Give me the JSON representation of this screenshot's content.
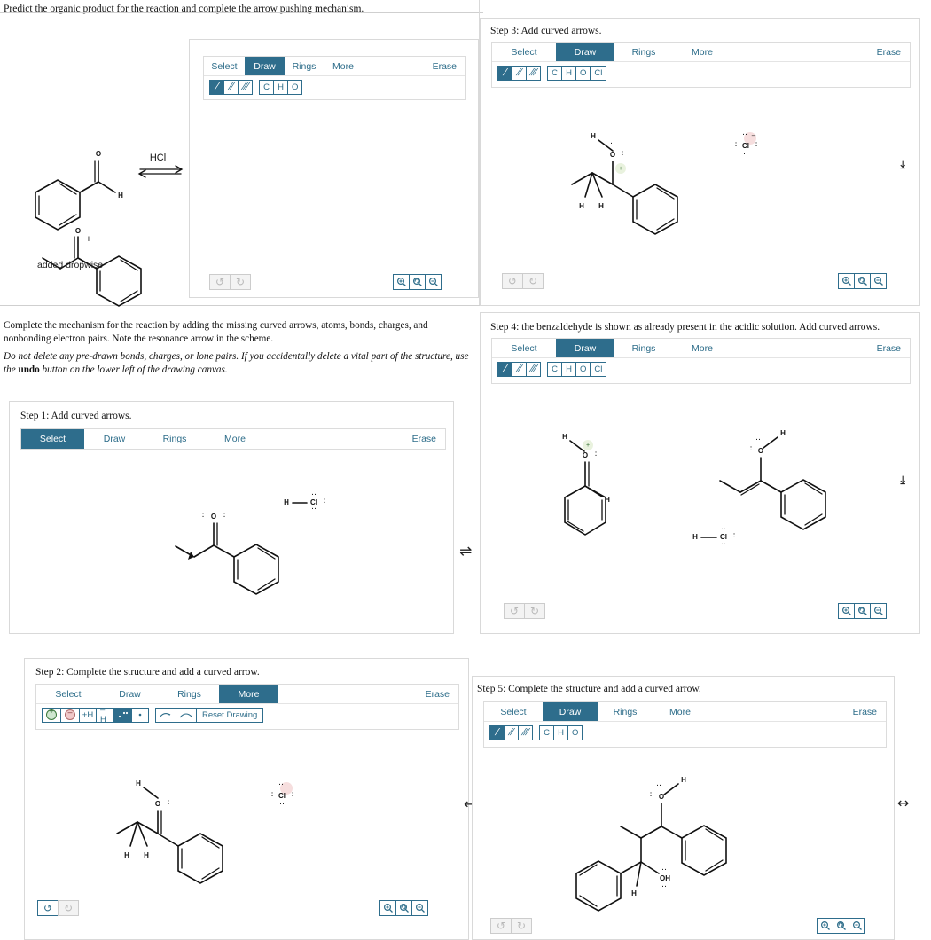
{
  "meta": {
    "accent": "#2e6d8c",
    "panel_border": "#d9d9d9",
    "pos_charge_color": "#2f6b2f",
    "neg_charge_color": "#c98e94"
  },
  "prompt": {
    "top": "Predict the organic product for the reaction and complete the arrow pushing mechanism.",
    "body_1": "Complete the mechanism for the reaction by adding the missing curved arrows, atoms, bonds, charges, and nonbonding electron pairs. Note the resonance arrow in the scheme.",
    "body_2_lead": "Do not delete any pre-drawn bonds, charges, or lone pairs. If you accidentally delete a vital part of the structure, use the ",
    "body_2_bold": "undo",
    "body_2_tail": " button on the lower left of the drawing canvas."
  },
  "scheme": {
    "reagent_label": "HCl",
    "caption": "added dropwise",
    "plus": "+",
    "reactant_1": "benzaldehyde",
    "reactant_2": "propiophenone"
  },
  "toolbar_tabs": {
    "select": "Select",
    "draw": "Draw",
    "rings": "Rings",
    "more": "More",
    "erase": "Erase"
  },
  "bond_buttons": {
    "single": "/",
    "double": "//",
    "triple": "///"
  },
  "more_buttons": {
    "plus_charge": "plus-charge",
    "minus_charge": "minus-charge",
    "add_h": "+H",
    "remove_h": "–H",
    "lone_pair": "lone-pair",
    "radical": "radical-dot",
    "arrow_single": "single-barb-arrow",
    "arrow_double": "double-barb-arrow",
    "reset": "Reset Drawing"
  },
  "bottom_controls": {
    "undo": "undo",
    "redo": "redo",
    "zoom_in": "zoom-in",
    "zoom_reset": "zoom-reset",
    "zoom_out": "zoom-out"
  },
  "panels": [
    {
      "id": "panel-main",
      "label": "",
      "active_tab": "Draw",
      "atom_buttons": [
        "C",
        "H",
        "O"
      ],
      "selected_bond": "single",
      "undo_enabled": false,
      "redo_enabled": false
    },
    {
      "id": "panel-step3",
      "label": "Step 3: Add curved arrows.",
      "active_tab": "Draw",
      "atom_buttons": [
        "C",
        "H",
        "O",
        "Cl"
      ],
      "selected_bond": "single",
      "undo_enabled": false,
      "redo_enabled": false
    },
    {
      "id": "panel-step1",
      "label": "Step 1: Add curved arrows.",
      "active_tab": "Select",
      "atom_buttons": [],
      "selected_bond": "",
      "undo_enabled": false,
      "redo_enabled": false
    },
    {
      "id": "panel-step4",
      "label": "Step 4: the benzaldehyde is shown as already present in the acidic solution. Add curved arrows.",
      "active_tab": "Draw",
      "atom_buttons": [
        "C",
        "H",
        "O",
        "Cl"
      ],
      "selected_bond": "single",
      "undo_enabled": false,
      "redo_enabled": false
    },
    {
      "id": "panel-step2",
      "label": "Step 2: Complete the structure and add a curved arrow.",
      "active_tab": "More",
      "atom_buttons": [],
      "selected_bond": "",
      "undo_enabled": true,
      "redo_enabled": false
    },
    {
      "id": "panel-step5",
      "label": "Step 5: Complete the structure and add a curved arrow.",
      "active_tab": "Draw",
      "atom_buttons": [
        "C",
        "H",
        "O"
      ],
      "selected_bond": "single",
      "undo_enabled": false,
      "redo_enabled": false
    }
  ],
  "atoms": {
    "H": "H",
    "O": "O",
    "Cl": "Cl",
    "OH": "OH",
    "plus": "+",
    "minus": "–"
  },
  "flow_arrows": {
    "resonance": "⇌",
    "left": "←",
    "double_head": "↔",
    "partial_right": "⇥"
  }
}
